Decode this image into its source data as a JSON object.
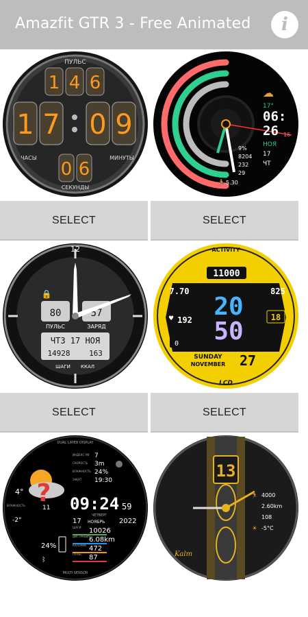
{
  "app": {
    "title": "Amazfit GTR 3 - Free Animated",
    "info_icon": "info-icon"
  },
  "select_label": "SELECT",
  "faces": [
    {
      "name": "nixie",
      "top_label": "ПУЛЬС",
      "pulse": [
        "1",
        "4",
        "6"
      ],
      "hours": [
        "1",
        "7"
      ],
      "minutes": [
        "0",
        "9"
      ],
      "seconds": [
        "0",
        "6"
      ],
      "hours_label": "ЧАСЫ",
      "minutes_label": "МИНУТЫ",
      "seconds_label": "СЕКУНДЫ"
    },
    {
      "name": "arcs",
      "temp": "17°",
      "time": "06:",
      "minute": "26",
      "date_small": "16",
      "month": "НОЯ",
      "day_num": "17",
      "weekday": "ЧТ",
      "battery": "9%",
      "steps": "8204",
      "val3": "232",
      "val4": "29",
      "val5": "5.30"
    },
    {
      "name": "analog",
      "top_num": "12",
      "pulse_val": "80",
      "battery_val": "57",
      "pulse_label": "ПУЛЬС",
      "battery_label": "ЗАРЯД",
      "date_line": "ЧТ3 17 НОЯ",
      "steps_line": "14928",
      "cal_line": "163",
      "steps_label": "ШАГИ",
      "cal_label": "ККАЛ"
    },
    {
      "name": "yellow",
      "activity_label": "ACTIVITY",
      "steps": "11000",
      "distance": "7.70",
      "calories": "825",
      "hour": "20",
      "minute": "50",
      "pulse": "192",
      "seconds": "18",
      "zero": "0",
      "weekday": "SUNDAY",
      "month": "NOVEMBER",
      "day": "27",
      "brand": "LCD"
    },
    {
      "name": "weather",
      "header": "DUAL LAYER DISPLAY",
      "temp": "4°",
      "temp_low": "-2°",
      "humidity_label": "ВЛАЖНОСТЬ",
      "badge": "11",
      "rows_top": [
        {
          "label": "ИНДЕКС УФ",
          "value": "7"
        },
        {
          "label": "СКОРОСТЬ",
          "value": "3m"
        },
        {
          "label": "ВЛАЖНОСТЬ",
          "value": "24%"
        },
        {
          "label": "ЗАКАТ",
          "value": "19:30"
        }
      ],
      "time": "09:24",
      "seconds": "59",
      "weekday": "ЧЕТВЕРГ",
      "day": "17",
      "month": "НОЯБРЬ",
      "year": "2022",
      "rows_bottom": [
        {
          "label": "ШАГИ",
          "value": "10026"
        },
        {
          "label": "ДИСТАНЦИЯ",
          "value": "6.08km"
        },
        {
          "label": "КАЛОРИИ",
          "value": "472"
        },
        {
          "label": "ПУЛЬС",
          "value": "87"
        }
      ],
      "battery": "24%",
      "footer": "MULTI SENSOR"
    },
    {
      "name": "carbon",
      "hour": "13",
      "steps": "4000",
      "distance": "2.60km",
      "value3": "108",
      "temp": "-5°C",
      "brand": "Kalm"
    }
  ],
  "colors": {
    "appbar": "#bdbdbd",
    "select_bg": "#d6d6d6",
    "nixie": "#ff9a1f",
    "arc_red": "#ff6b6b",
    "arc_green": "#2fcf8f",
    "yellow": "#f3cf00",
    "lcd_blue": "#48b4ff",
    "gold": "#e7b21c"
  }
}
